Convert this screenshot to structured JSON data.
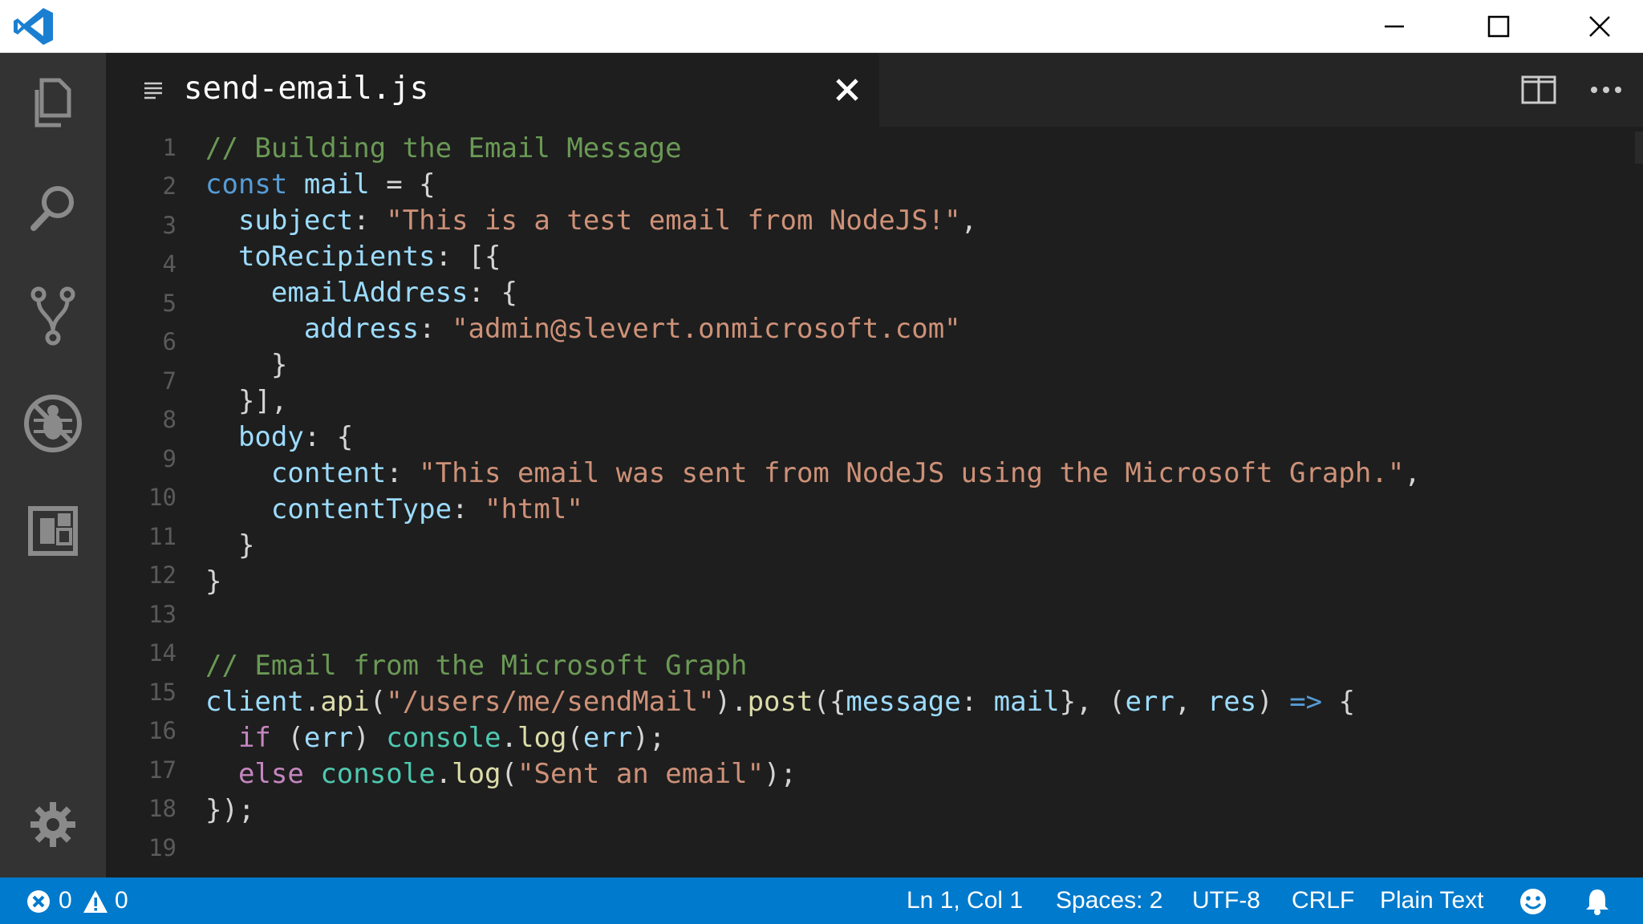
{
  "tab": {
    "filename": "send-email.js"
  },
  "editor": {
    "line_numbers": [
      "1",
      "2",
      "3",
      "4",
      "5",
      "6",
      "7",
      "8",
      "9",
      "10",
      "11",
      "12",
      "13",
      "14",
      "15",
      "16",
      "17",
      "18",
      "19"
    ]
  },
  "code": {
    "l1": "// Building the Email Message",
    "l2_kw": "const",
    "l2_var": "mail",
    "l2_rest": " = {",
    "l3_key": "subject",
    "l3_str": "\"This is a test email from NodeJS!\"",
    "l4_key": "toRecipients",
    "l4_rest": ": [{",
    "l5_key": "emailAddress",
    "l5_rest": ": {",
    "l6_key": "address",
    "l6_str": "\"admin@slevert.onmicrosoft.com\"",
    "l7": "}",
    "l8": "}],",
    "l9_key": "body",
    "l9_rest": ": {",
    "l10_key": "content",
    "l10_str": "\"This email was sent from NodeJS using the Microsoft Graph.\"",
    "l11_key": "contentType",
    "l11_str": "\"html\"",
    "l12": "}",
    "l13": "}",
    "l15": "// Email from the Microsoft Graph",
    "l16_obj": "client",
    "l16_fn1": "api",
    "l16_str": "\"/users/me/sendMail\"",
    "l16_fn2": "post",
    "l16_key": "message",
    "l16_val": "mail",
    "l16_p1": "err",
    "l16_p2": "res",
    "l16_arrow": "=>",
    "l17_kw": "if",
    "l17_arg": "err",
    "l17_obj": "console",
    "l17_fn": "log",
    "l17_arg2": "err",
    "l18_kw": "else",
    "l18_obj": "console",
    "l18_fn": "log",
    "l18_str": "\"Sent an email\"",
    "l19": "});"
  },
  "status": {
    "errors": "0",
    "warnings": "0",
    "position": "Ln 1, Col 1",
    "spaces": "Spaces: 2",
    "encoding": "UTF-8",
    "eol": "CRLF",
    "language": "Plain Text"
  },
  "icons": {
    "titlebar": [
      "vscode-logo",
      "minimize-icon",
      "maximize-icon",
      "close-icon"
    ],
    "activitybar": [
      "explorer-icon",
      "search-icon",
      "source-control-icon",
      "debug-icon",
      "extensions-icon",
      "settings-gear-icon"
    ],
    "tab": [
      "file-lines-icon",
      "tab-close-icon",
      "split-editor-icon",
      "more-actions-icon"
    ],
    "statusbar": [
      "error-icon",
      "warning-icon",
      "feedback-smiley-icon",
      "notifications-bell-icon"
    ]
  },
  "colors": {
    "accent": "#007acc",
    "editor_bg": "#1e1e1e",
    "activity_bg": "#333333",
    "comment": "#6a9955",
    "keyword": "#569cd6",
    "variable": "#9cdcfe",
    "string": "#ce9178",
    "control_flow": "#c586c0",
    "class": "#4ec9b0",
    "function": "#dcdcaa"
  }
}
